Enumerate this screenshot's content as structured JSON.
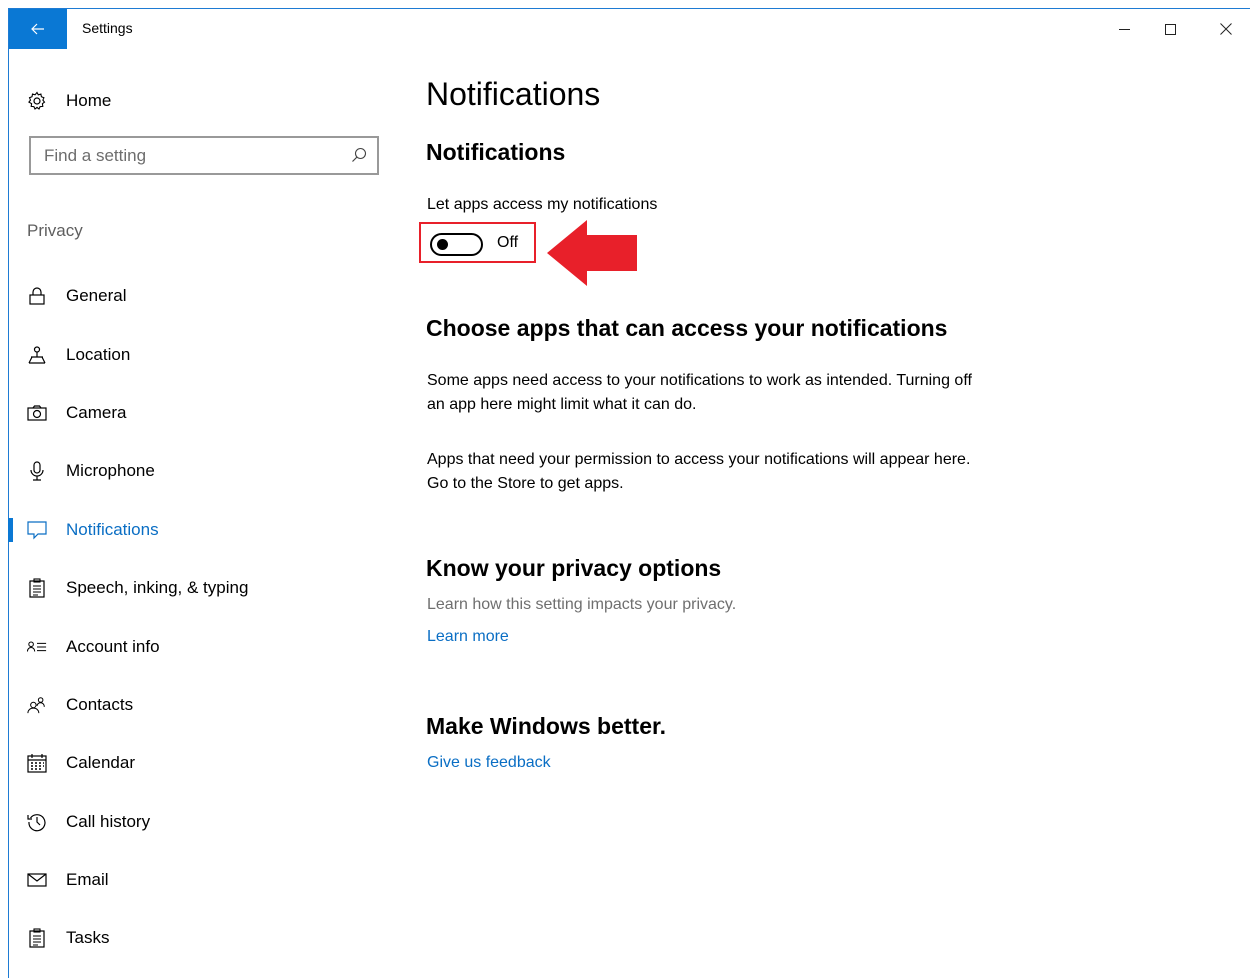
{
  "window": {
    "title": "Settings",
    "controls": {
      "minimize": "–",
      "maximize": "□",
      "close": "✕"
    }
  },
  "sidebar": {
    "home_label": "Home",
    "search": {
      "placeholder": "Find a setting",
      "value": ""
    },
    "section_label": "Privacy",
    "items": [
      {
        "label": "General",
        "icon": "lock-icon"
      },
      {
        "label": "Location",
        "icon": "location-icon"
      },
      {
        "label": "Camera",
        "icon": "camera-icon"
      },
      {
        "label": "Microphone",
        "icon": "microphone-icon"
      },
      {
        "label": "Notifications",
        "icon": "notification-icon",
        "active": true
      },
      {
        "label": "Speech, inking, & typing",
        "icon": "speech-icon"
      },
      {
        "label": "Account info",
        "icon": "account-info-icon"
      },
      {
        "label": "Contacts",
        "icon": "contacts-icon"
      },
      {
        "label": "Calendar",
        "icon": "calendar-icon"
      },
      {
        "label": "Call history",
        "icon": "history-icon"
      },
      {
        "label": "Email",
        "icon": "email-icon"
      },
      {
        "label": "Tasks",
        "icon": "tasks-icon"
      }
    ]
  },
  "main": {
    "title": "Notifications",
    "notifications_heading": "Notifications",
    "setting_label": "Let apps access my notifications",
    "toggle": {
      "state": "Off",
      "on": false
    },
    "choose_heading": "Choose apps that can access your notifications",
    "choose_para1": "Some apps need access to your notifications to work as intended. Turning off an app here might limit what it can do.",
    "choose_para2": "Apps that need your permission to access your notifications will appear here. Go to the Store to get apps.",
    "privacy_heading": "Know your privacy options",
    "privacy_desc": "Learn how this setting impacts your privacy.",
    "learn_more": "Learn more",
    "better_heading": "Make Windows better.",
    "feedback_link": "Give us feedback"
  },
  "colors": {
    "accent": "#0a78d4",
    "link": "#0a6ec4",
    "highlight_frame": "#e8202a",
    "arrow": "#e8202a"
  }
}
